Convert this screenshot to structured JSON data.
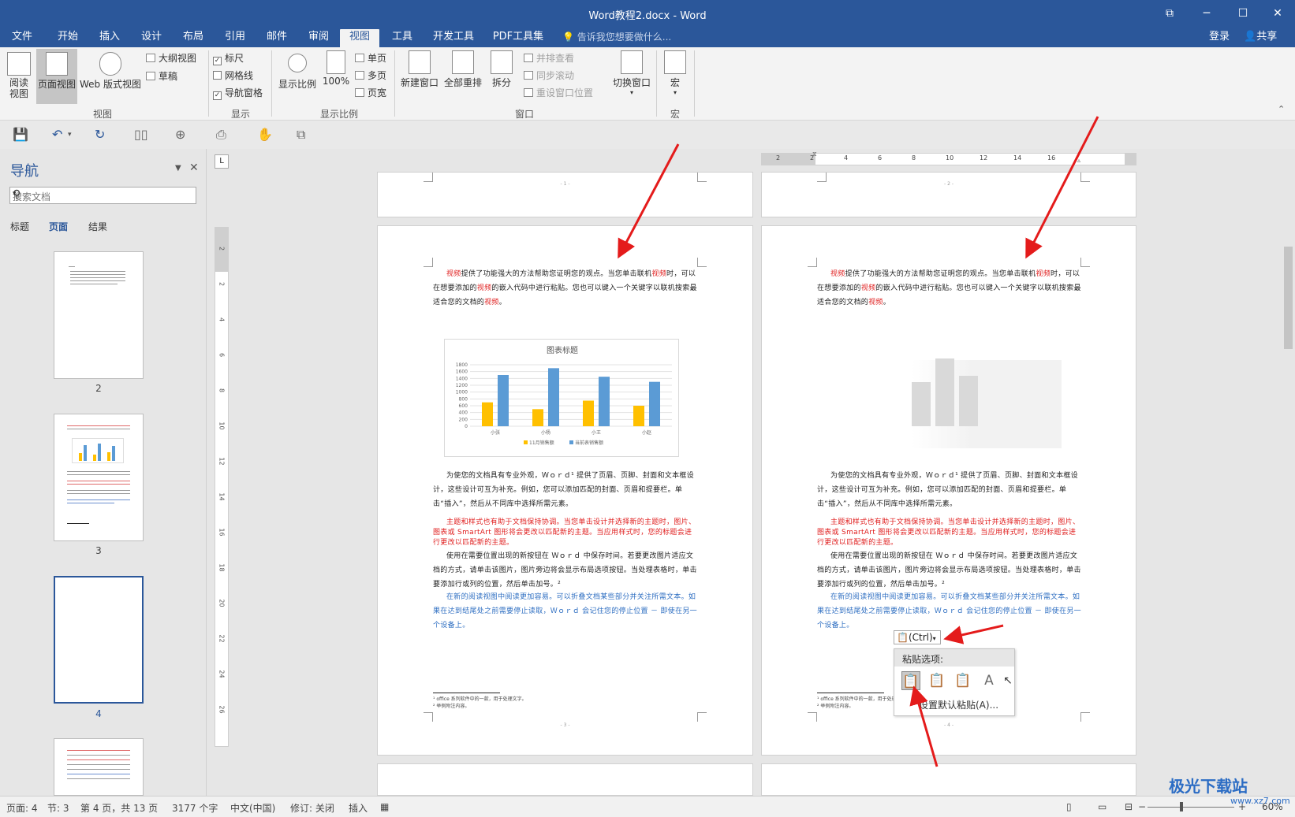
{
  "window": {
    "title": "Word教程2.docx - Word",
    "controls": [
      "⧉",
      "─",
      "☐",
      "✕"
    ]
  },
  "tabs": [
    "文件",
    "开始",
    "插入",
    "设计",
    "布局",
    "引用",
    "邮件",
    "审阅",
    "视图",
    "工具",
    "开发工具",
    "PDF工具集"
  ],
  "active_tab": "视图",
  "tell_me": "告诉我您想要做什么...",
  "login": "登录",
  "share": "共享",
  "ribbon": {
    "view_group": {
      "read": "阅读\n视图",
      "print": "页面视图",
      "web": "Web 版式视图",
      "outline": "大纲视图",
      "draft": "草稿",
      "label": "视图"
    },
    "show_group": {
      "ruler": "标尺",
      "grid": "网格线",
      "navpane": "导航窗格",
      "label": "显示",
      "ruler_checked": true,
      "grid_checked": false,
      "navpane_checked": true
    },
    "zoom_group": {
      "zoom": "显示比例",
      "hundred": "100%",
      "one_page": "单页",
      "multi_page": "多页",
      "page_width": "页宽",
      "label": "显示比例"
    },
    "window_group": {
      "new_window": "新建窗口",
      "arrange_all": "全部重排",
      "split": "拆分",
      "side_by_side": "并排查看",
      "sync_scroll": "同步滚动",
      "reset_pos": "重设窗口位置",
      "switch": "切换窗口",
      "label": "窗口"
    },
    "macro_group": {
      "macro": "宏",
      "label": "宏"
    }
  },
  "nav": {
    "title": "导航",
    "search_placeholder": "搜索文档",
    "tabs": [
      "标题",
      "页面",
      "结果"
    ],
    "active_tab": "页面",
    "pages": [
      "2",
      "3",
      "4"
    ],
    "selected_page": "4"
  },
  "ruler": {
    "h_ticks": [
      "2",
      "2",
      "4",
      "6",
      "8",
      "10",
      "12",
      "14",
      "16"
    ],
    "v_ticks": [
      "2",
      "2",
      "4",
      "6",
      "8",
      "10",
      "12",
      "14",
      "16",
      "18",
      "20",
      "22",
      "24",
      "26"
    ]
  },
  "document": {
    "page_numbers": [
      "1",
      "2",
      "3",
      "4"
    ],
    "para1": [
      {
        "t": "视频",
        "red": true
      },
      {
        "t": "提供了功能强大的方法帮助您证明您的观点。当您单击联机",
        "red": false
      },
      {
        "t": "视频",
        "red": true
      },
      {
        "t": "时，可以在想要添加的",
        "red": false
      },
      {
        "t": "视频",
        "red": true
      },
      {
        "t": "的嵌入代码中进行粘贴。您也可以键入一个关键字以联机搜索最适合您的文档的",
        "red": false
      },
      {
        "t": "视频",
        "red": true
      },
      {
        "t": "。",
        "red": false
      }
    ],
    "para2": "为使您的文档具有专业外观，Ｗｏｒｄ¹ 提供了页眉、页脚、封面和文本框设计，这些设计可互为补充。例如，您可以添加匹配的封面、页眉和提要栏。单击“插入”，然后从不同库中选择所需元素。",
    "para3": "主题和样式也有助于文档保持协调。当您单击设计并选择新的主题时，图片、图表或 SmartArt 图形将会更改以匹配新的主题。当应用样式时，您的标题会进行更改以匹配新的主题。",
    "para4": "使用在需要位置出现的新按钮在 Ｗｏｒｄ 中保存时间。若要更改图片适应文档的方式，请单击该图片，图片旁边将会显示布局选项按钮。当处理表格时，单击要添加行或列的位置，然后单击加号。²",
    "para5": "在新的阅读视图中阅读更加容易。可以折叠文档某些部分并关注所需文本。如果在达到结尾处之前需要停止读取，Ｗｏｒｄ 会记住您的停止位置 － 即使在另一个设备上。",
    "footnote1": "¹ office 系列软件中的一款，用于处理文字。",
    "footnote2": "² 举例附注内容。"
  },
  "chart_data": {
    "type": "bar",
    "title": "图表标题",
    "categories": [
      "小张",
      "小杨",
      "小王",
      "小赵"
    ],
    "series": [
      {
        "name": "11月销售额",
        "values": [
          700,
          500,
          750,
          600
        ]
      },
      {
        "name": "当前表销售额",
        "values": [
          1500,
          1700,
          1450,
          1300
        ]
      }
    ],
    "ylim": [
      0,
      1800
    ],
    "y_ticks": [
      "1800",
      "1600",
      "1400",
      "1200",
      "1000",
      "800",
      "600",
      "400",
      "200",
      "0"
    ],
    "colors": [
      "#ffc000",
      "#5b9bd5"
    ],
    "legend": "bottom",
    "grid": true
  },
  "paste": {
    "ctrl_label": "(Ctrl)",
    "header": "粘贴选项:",
    "set_default": "设置默认粘贴(A)...",
    "icons": [
      "paste-keep-source-icon",
      "paste-merge-format-icon",
      "paste-picture-icon",
      "paste-text-only-icon"
    ]
  },
  "status": {
    "page": "页面: 4",
    "section": "节: 3",
    "pageof": "第 4 页，共 13 页",
    "words": "3177 个字",
    "lang": "中文(中国)",
    "track": "修订: 关闭",
    "insert": "插入",
    "zoom": "60%"
  },
  "watermark": {
    "text": "极光下载站",
    "url": "www.xz7.com"
  },
  "accent": "#2b579a"
}
